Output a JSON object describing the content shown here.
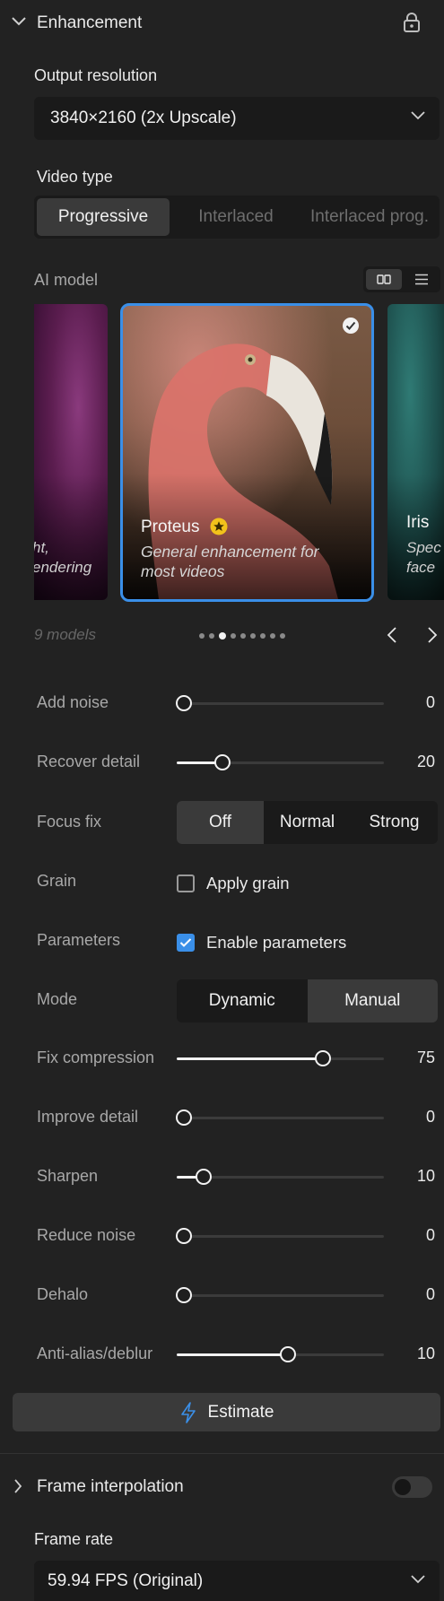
{
  "enhancement": {
    "title": "Enhancement",
    "output_resolution_label": "Output resolution",
    "output_resolution_value": "3840×2160 (2x Upscale)",
    "video_type_label": "Video type",
    "video_type_options": [
      "Progressive",
      "Interlaced",
      "Interlaced prog."
    ],
    "video_type_selected": "Progressive"
  },
  "ai_model": {
    "label": "AI model",
    "left_card_text": [
      "ht,",
      "endering"
    ],
    "main_card": {
      "name": "Proteus",
      "description": [
        "General enhancement for",
        "most videos"
      ]
    },
    "right_card": {
      "name": "Iris",
      "desc": [
        "Spec",
        "face"
      ]
    },
    "count": "9 models",
    "dots": 9,
    "active_dot": 2
  },
  "settings": {
    "add_noise": {
      "label": "Add noise",
      "value": "0",
      "fraction": 0.0
    },
    "recover_detail": {
      "label": "Recover detail",
      "value": "20",
      "fraction": 0.2
    },
    "focus_fix": {
      "label": "Focus fix",
      "options": [
        "Off",
        "Normal",
        "Strong"
      ],
      "selected": "Off"
    },
    "grain": {
      "label": "Grain",
      "checkbox_label": "Apply grain",
      "checked": false
    },
    "parameters": {
      "label": "Parameters",
      "checkbox_label": "Enable parameters",
      "checked": true
    },
    "mode": {
      "label": "Mode",
      "options": [
        "Dynamic",
        "Manual"
      ],
      "selected": "Manual"
    },
    "fix_compression": {
      "label": "Fix compression",
      "value": "75",
      "fraction": 0.72
    },
    "improve_detail": {
      "label": "Improve detail",
      "value": "0",
      "fraction": 0.0
    },
    "sharpen": {
      "label": "Sharpen",
      "value": "10",
      "fraction": 0.1
    },
    "reduce_noise": {
      "label": "Reduce noise",
      "value": "0",
      "fraction": 0.0
    },
    "dehalo": {
      "label": "Dehalo",
      "value": "0",
      "fraction": 0.0
    },
    "anti_alias": {
      "label": "Anti-alias/deblur",
      "value": "10",
      "fraction": 0.54
    }
  },
  "estimate_label": "Estimate",
  "frame_interpolation": {
    "title": "Frame interpolation",
    "enabled": false,
    "frame_rate_label": "Frame rate",
    "frame_rate_value": "59.94 FPS (Original)"
  },
  "colors": {
    "accent": "#3a8fe8",
    "star": "#f2c21b"
  }
}
